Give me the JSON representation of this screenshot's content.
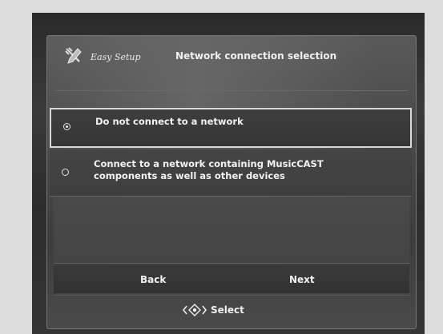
{
  "header": {
    "app_title": "Easy Setup",
    "page_title": "Network connection selection"
  },
  "options": [
    {
      "label": "Do not connect to a network",
      "selected": true
    },
    {
      "label": "Connect to a network containing MusicCAST components as well as other devices",
      "selected": false
    }
  ],
  "nav": {
    "back_label": "Back",
    "next_label": "Next"
  },
  "footer": {
    "icon": "dpad-icon",
    "select_label": "Select"
  }
}
